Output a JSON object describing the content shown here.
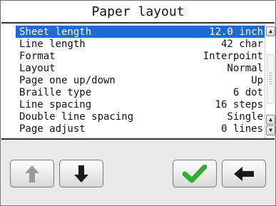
{
  "title": "Paper layout",
  "settings": [
    {
      "label": "Sheet length",
      "value": "12.0 inch"
    },
    {
      "label": "Line length",
      "value": "42 char"
    },
    {
      "label": "Format",
      "value": "Interpoint"
    },
    {
      "label": "Layout",
      "value": "Normal"
    },
    {
      "label": "Page one up/down",
      "value": "Up"
    },
    {
      "label": "Braille type",
      "value": "6 dot"
    },
    {
      "label": "Line spacing",
      "value": "16 steps"
    },
    {
      "label": "Double line spacing",
      "value": "Single"
    },
    {
      "label": "Page adjust",
      "value": "0 lines"
    }
  ],
  "selected_index": 0,
  "colors": {
    "selection": "#1d6bd0",
    "confirm": "#2fae2f"
  },
  "icons": {
    "scroll_up": "arrow-up-small-icon",
    "scroll_up_lower": "arrow-up-small-icon",
    "scroll_down": "arrow-down-small-icon",
    "move_up": "arrow-up-icon",
    "move_down": "arrow-down-icon",
    "confirm": "checkmark-icon",
    "back": "arrow-left-icon"
  }
}
